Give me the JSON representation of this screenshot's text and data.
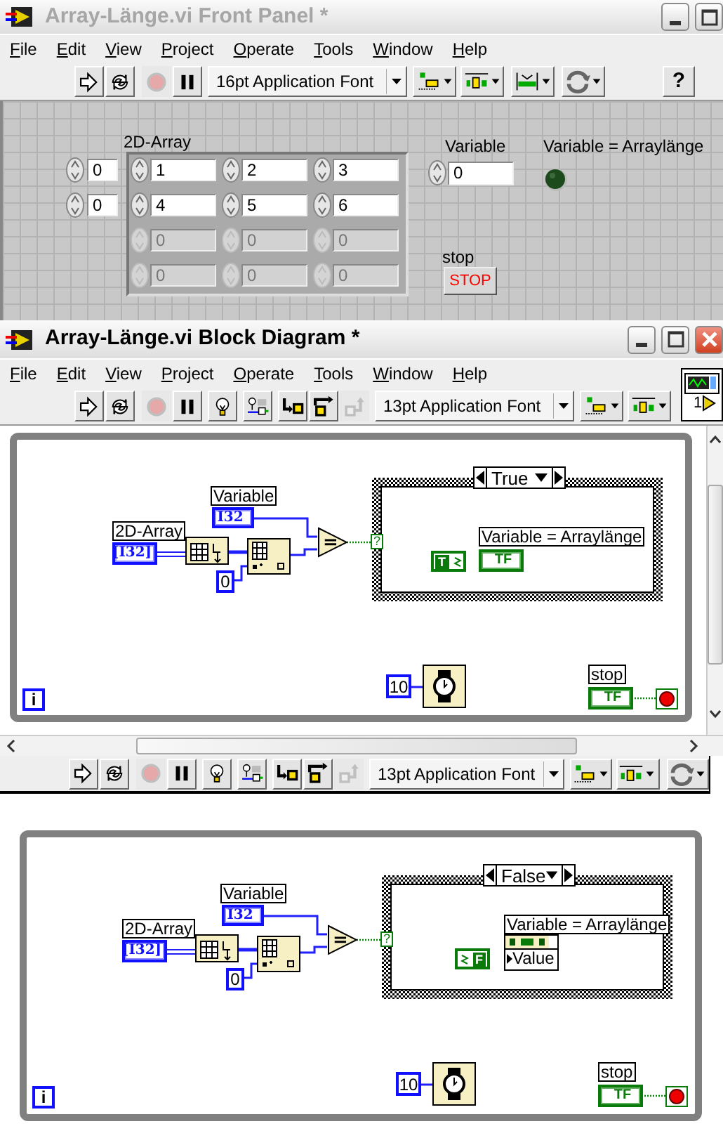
{
  "front_panel": {
    "title": "Array-Länge.vi Front Panel *",
    "active": false,
    "title_buttons": [
      {
        "kind": "minimize"
      },
      {
        "kind": "maximize"
      }
    ],
    "menu": [
      "File",
      "Edit",
      "View",
      "Project",
      "Operate",
      "Tools",
      "Window",
      "Help"
    ],
    "toolbar": [
      {
        "kind": "run",
        "disabled": false
      },
      {
        "kind": "run_continuously",
        "disabled": false
      },
      {
        "kind": "abort",
        "disabled": true
      },
      {
        "kind": "pause",
        "disabled": false
      },
      {
        "kind": "font",
        "text": "16pt Application Font",
        "disabled": false
      },
      {
        "kind": "align",
        "disabled": false
      },
      {
        "kind": "distribute",
        "disabled": false
      },
      {
        "kind": "resize",
        "disabled": false
      },
      {
        "kind": "reorder",
        "disabled": false
      },
      {
        "kind": "help",
        "text": "?",
        "disabled": false
      }
    ],
    "array": {
      "label": "2D-Array",
      "indices": [
        "0",
        "0"
      ],
      "rows": [
        [
          {
            "value": "1",
            "disabled": false
          },
          {
            "value": "2",
            "disabled": false
          },
          {
            "value": "3",
            "disabled": false
          }
        ],
        [
          {
            "value": "4",
            "disabled": false
          },
          {
            "value": "5",
            "disabled": false
          },
          {
            "value": "6",
            "disabled": false
          }
        ],
        [
          {
            "value": "0",
            "disabled": true
          },
          {
            "value": "0",
            "disabled": true
          },
          {
            "value": "0",
            "disabled": true
          }
        ],
        [
          {
            "value": "0",
            "disabled": true
          },
          {
            "value": "0",
            "disabled": true
          },
          {
            "value": "0",
            "disabled": true
          }
        ]
      ]
    },
    "variable": {
      "label": "Variable",
      "value": "0"
    },
    "led": {
      "label": "Variable = Arraylänge",
      "on": false
    },
    "stop_button": {
      "label": "stop",
      "text": "STOP"
    }
  },
  "block_diagram": {
    "title": "Array-Länge.vi Block Diagram *",
    "active": true,
    "title_buttons": [
      {
        "kind": "minimize"
      },
      {
        "kind": "maximize"
      },
      {
        "kind": "close"
      }
    ],
    "menu": [
      "File",
      "Edit",
      "View",
      "Project",
      "Operate",
      "Tools",
      "Window",
      "Help"
    ],
    "toolbar": [
      {
        "kind": "run",
        "disabled": false
      },
      {
        "kind": "run_continuously",
        "disabled": false
      },
      {
        "kind": "abort",
        "disabled": true
      },
      {
        "kind": "pause",
        "disabled": false
      },
      {
        "kind": "highlight",
        "disabled": false
      },
      {
        "kind": "retain",
        "disabled": false
      },
      {
        "kind": "step_into",
        "disabled": false
      },
      {
        "kind": "step_over",
        "disabled": false
      },
      {
        "kind": "step_out",
        "disabled": true
      },
      {
        "kind": "font",
        "text": "13pt Application Font",
        "disabled": false
      },
      {
        "kind": "align",
        "disabled": false
      },
      {
        "kind": "distribute",
        "disabled": false
      }
    ],
    "connector_pane": {
      "number": "1"
    },
    "diagram": {
      "variable_label": "Variable",
      "variable_terminal": "I32",
      "array_label": "2D-Array",
      "array_terminal": "[I32]",
      "index_constant": "0",
      "equal_symbol": "=",
      "selector_mark": "?",
      "case": {
        "value": "True",
        "bool_constant": "T",
        "indicator_label": "Variable = Arraylänge",
        "target": {
          "kind": "terminal",
          "text": "TF"
        }
      },
      "wait_constant": "10",
      "iteration": "i",
      "stop_label": "stop",
      "stop_terminal": "TF"
    }
  },
  "toolbar_copy": [
    {
      "kind": "run",
      "disabled": false
    },
    {
      "kind": "run_continuously",
      "disabled": false
    },
    {
      "kind": "abort",
      "disabled": true
    },
    {
      "kind": "pause",
      "disabled": false
    },
    {
      "kind": "highlight",
      "disabled": false
    },
    {
      "kind": "retain",
      "disabled": false
    },
    {
      "kind": "step_into",
      "disabled": false
    },
    {
      "kind": "step_over",
      "disabled": false
    },
    {
      "kind": "step_out",
      "disabled": true
    },
    {
      "kind": "font",
      "text": "13pt Application Font",
      "disabled": false
    },
    {
      "kind": "align",
      "disabled": false
    },
    {
      "kind": "distribute",
      "disabled": false
    },
    {
      "kind": "reorder",
      "disabled": false
    }
  ],
  "diagram_false": {
    "variable_label": "Variable",
    "variable_terminal": "I32",
    "array_label": "2D-Array",
    "array_terminal": "[I32]",
    "index_constant": "0",
    "equal_symbol": "=",
    "selector_mark": "?",
    "case": {
      "value": "False",
      "bool_constant": "F",
      "indicator_label": "Variable = Arraylänge",
      "target": {
        "kind": "property",
        "text": "Value"
      }
    },
    "wait_constant": "10",
    "iteration": "i",
    "stop_label": "stop",
    "stop_terminal": "TF"
  }
}
